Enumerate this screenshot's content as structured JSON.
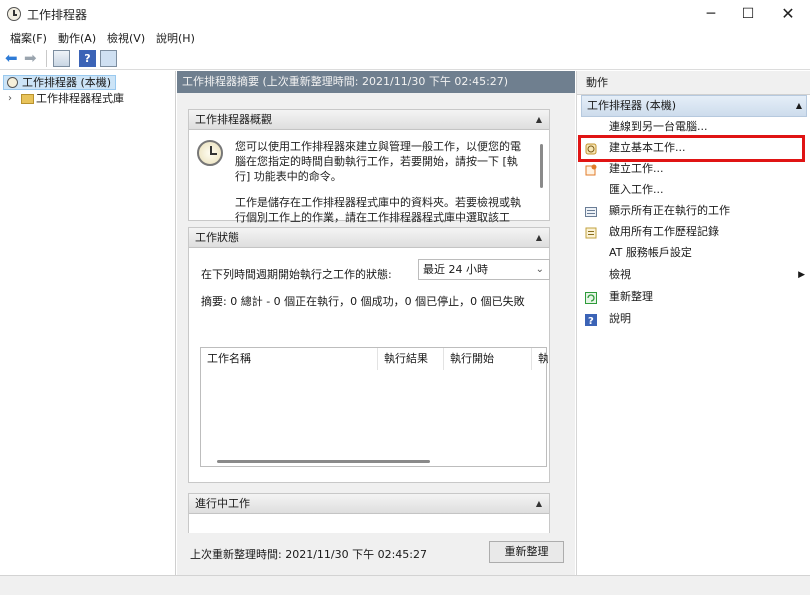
{
  "window": {
    "title": "工作排程器",
    "minimize_glyph": "─",
    "maximize_glyph": "☐",
    "close_glyph": "✕"
  },
  "menu": [
    "檔案(F)",
    "動作(A)",
    "檢視(V)",
    "說明(H)"
  ],
  "toolbar": {
    "back_glyph": "⬅",
    "forward_glyph": "➡",
    "help_glyph": "?"
  },
  "tree": {
    "root_label": "工作排程器 (本機)",
    "library_label": "工作排程器程式庫",
    "expand_glyph": "›"
  },
  "center": {
    "header": "工作排程器摘要 (上次重新整理時間: 2021/11/30 下午 02:45:27)",
    "overview": {
      "title": "工作排程器概觀",
      "para1": "您可以使用工作排程器來建立與管理一般工作，以便您的電腦在您指定的時間自動執行工作，若要開始，請按一下 [執行] 功能表中的命令。",
      "para2": "工作是儲存在工作排程器程式庫中的資料夾。若要檢視或執行個別工作上的作業，請在工作排程器程式庫中選取該工"
    },
    "status": {
      "title": "工作狀態",
      "period_label": "在下列時間週期開始執行之工作的狀態:",
      "period_value": "最近 24 小時",
      "summary": "摘要: 0 總計 - 0 個正在執行，0 個成功，0 個已停止，0 個已失敗",
      "columns": [
        "工作名稱",
        "執行結果",
        "執行開始",
        "執"
      ]
    },
    "running": {
      "title": "進行中工作"
    },
    "footer_text": "上次重新整理時間: 2021/11/30 下午 02:45:27",
    "refresh_button": "重新整理",
    "collapse_glyph": "▲"
  },
  "actions": {
    "header": "動作",
    "group": "工作排程器 (本機)",
    "items": [
      {
        "label": "連線到另一台電腦...",
        "icon": "none"
      },
      {
        "label": "建立基本工作...",
        "icon": "basic-task-icon",
        "color": "#d9a93b"
      },
      {
        "label": "建立工作...",
        "icon": "create-task-icon",
        "color": "#e07b2a"
      },
      {
        "label": "匯入工作...",
        "icon": "none"
      },
      {
        "label": "顯示所有正在執行的工作",
        "icon": "running-tasks-icon",
        "color": "#6a7d96"
      },
      {
        "label": "啟用所有工作歷程記錄",
        "icon": "history-icon",
        "color": "#c2a23f"
      },
      {
        "label": "AT 服務帳戶設定",
        "icon": "none"
      },
      {
        "label": "檢視",
        "icon": "none",
        "submenu": "▶"
      },
      {
        "label": "重新整理",
        "icon": "refresh-icon",
        "color": "#2e9b3a"
      },
      {
        "label": "說明",
        "icon": "help-icon",
        "color": "#3b63b6"
      }
    ]
  },
  "highlight_color": "#e01414"
}
